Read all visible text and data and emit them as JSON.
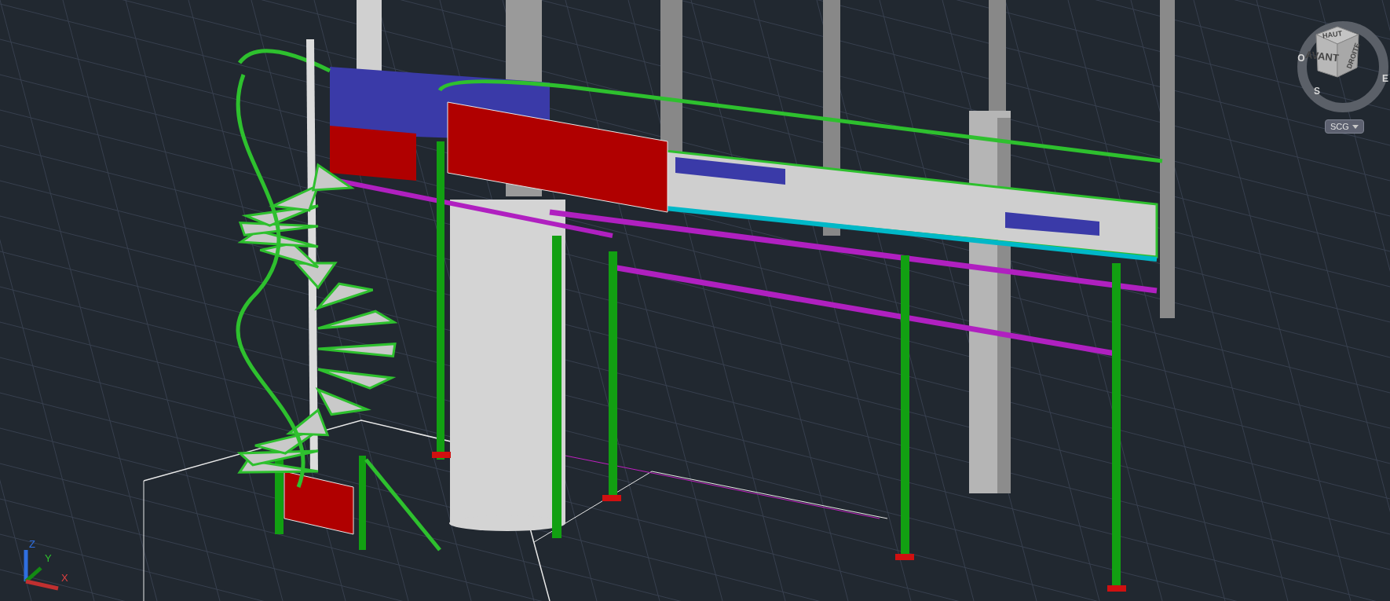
{
  "viewcube": {
    "faces": [
      {
        "kind": "top",
        "label": "HAUT"
      },
      {
        "kind": "front",
        "label": "AVANT"
      },
      {
        "kind": "right",
        "label": "DROITE"
      }
    ],
    "compass": [
      {
        "kind": "west",
        "label": "O"
      },
      {
        "kind": "south",
        "label": "S"
      },
      {
        "kind": "east",
        "label": "E"
      }
    ]
  },
  "ucs_menu": {
    "label": "SCG"
  },
  "ucs_icon": {
    "axes": [
      {
        "kind": "z",
        "label": "Z"
      },
      {
        "kind": "y",
        "label": "Y"
      },
      {
        "kind": "x",
        "label": "X"
      }
    ]
  }
}
